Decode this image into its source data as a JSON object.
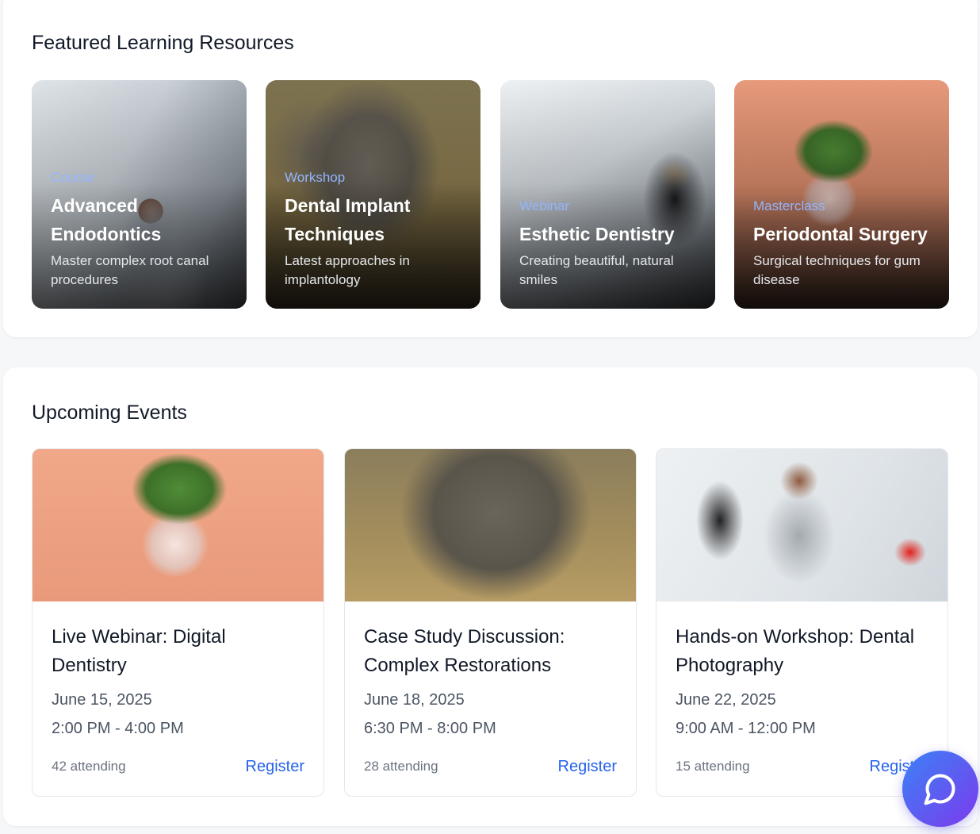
{
  "featured": {
    "title": "Featured Learning Resources",
    "cards": [
      {
        "type": "Course",
        "title": "Advanced Endodontics",
        "description": "Master complex root canal procedures",
        "image": "dentist-patient-photo"
      },
      {
        "type": "Workshop",
        "title": "Dental Implant Techniques",
        "description": "Latest approaches in implantology",
        "image": "elephant-photo"
      },
      {
        "type": "Webinar",
        "title": "Esthetic Dentistry",
        "description": "Creating beautiful, natural smiles",
        "image": "dental-clinic-photo"
      },
      {
        "type": "Masterclass",
        "title": "Periodontal Surgery",
        "description": "Surgical techniques for gum disease",
        "image": "plant-in-bowl-photo"
      }
    ]
  },
  "events": {
    "title": "Upcoming Events",
    "items": [
      {
        "title": "Live Webinar: Digital Dentistry",
        "date": "June 15, 2025",
        "time": "2:00 PM - 4:00 PM",
        "attending": "42 attending",
        "register_label": "Register",
        "image": "plant-in-bowl-photo"
      },
      {
        "title": "Case Study Discussion: Complex Restorations",
        "date": "June 18, 2025",
        "time": "6:30 PM - 8:00 PM",
        "attending": "28 attending",
        "register_label": "Register",
        "image": "elephant-photo"
      },
      {
        "title": "Hands-on Workshop: Dental Photography",
        "date": "June 22, 2025",
        "time": "9:00 AM - 12:00 PM",
        "attending": "15 attending",
        "register_label": "Register",
        "image": "dentist-patient-photo"
      }
    ]
  },
  "chat": {
    "icon": "chat-bubble-icon"
  },
  "colors": {
    "accent": "#2563eb",
    "type_label": "#93b5ff",
    "chat_gradient_start": "#3b82f6",
    "chat_gradient_end": "#7c3aed"
  }
}
